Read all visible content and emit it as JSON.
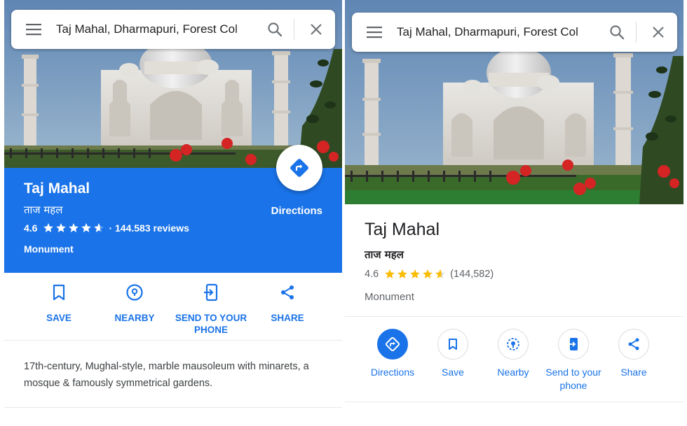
{
  "left": {
    "search": {
      "query": "Taj Mahal, Dharmapuri, Forest Col"
    },
    "place": {
      "name": "Taj Mahal",
      "alt_name": "ताज महल",
      "rating": "4.6",
      "rating_value": 4.6,
      "reviews": "· 144.583 reviews",
      "category": "Monument",
      "directions_label": "Directions"
    },
    "actions": [
      {
        "label": "SAVE",
        "icon": "bookmark-icon"
      },
      {
        "label": "NEARBY",
        "icon": "nearby-pin-icon"
      },
      {
        "label": "SEND TO YOUR PHONE",
        "icon": "send-to-phone-icon"
      },
      {
        "label": "SHARE",
        "icon": "share-icon"
      }
    ],
    "description": "17th-century, Mughal-style, marble mausoleum with minarets, a mosque & famously symmetrical gardens."
  },
  "right": {
    "search": {
      "query": "Taj Mahal, Dharmapuri, Forest Col"
    },
    "place": {
      "name": "Taj Mahal",
      "alt_name": "ताज महल",
      "rating": "4.6",
      "rating_value": 4.6,
      "reviews": "(144,582)",
      "category": "Monument"
    },
    "actions": [
      {
        "label": "Directions",
        "icon": "directions-icon"
      },
      {
        "label": "Save",
        "icon": "bookmark-icon"
      },
      {
        "label": "Nearby",
        "icon": "nearby-pin-icon"
      },
      {
        "label": "Send to your phone",
        "icon": "send-to-phone-icon"
      },
      {
        "label": "Share",
        "icon": "share-icon"
      }
    ]
  },
  "colors": {
    "accent_blue": "#1a73e8",
    "star_white": "#ffffff",
    "star_yellow": "#fbbc04",
    "text_gray": "#5f6368"
  }
}
